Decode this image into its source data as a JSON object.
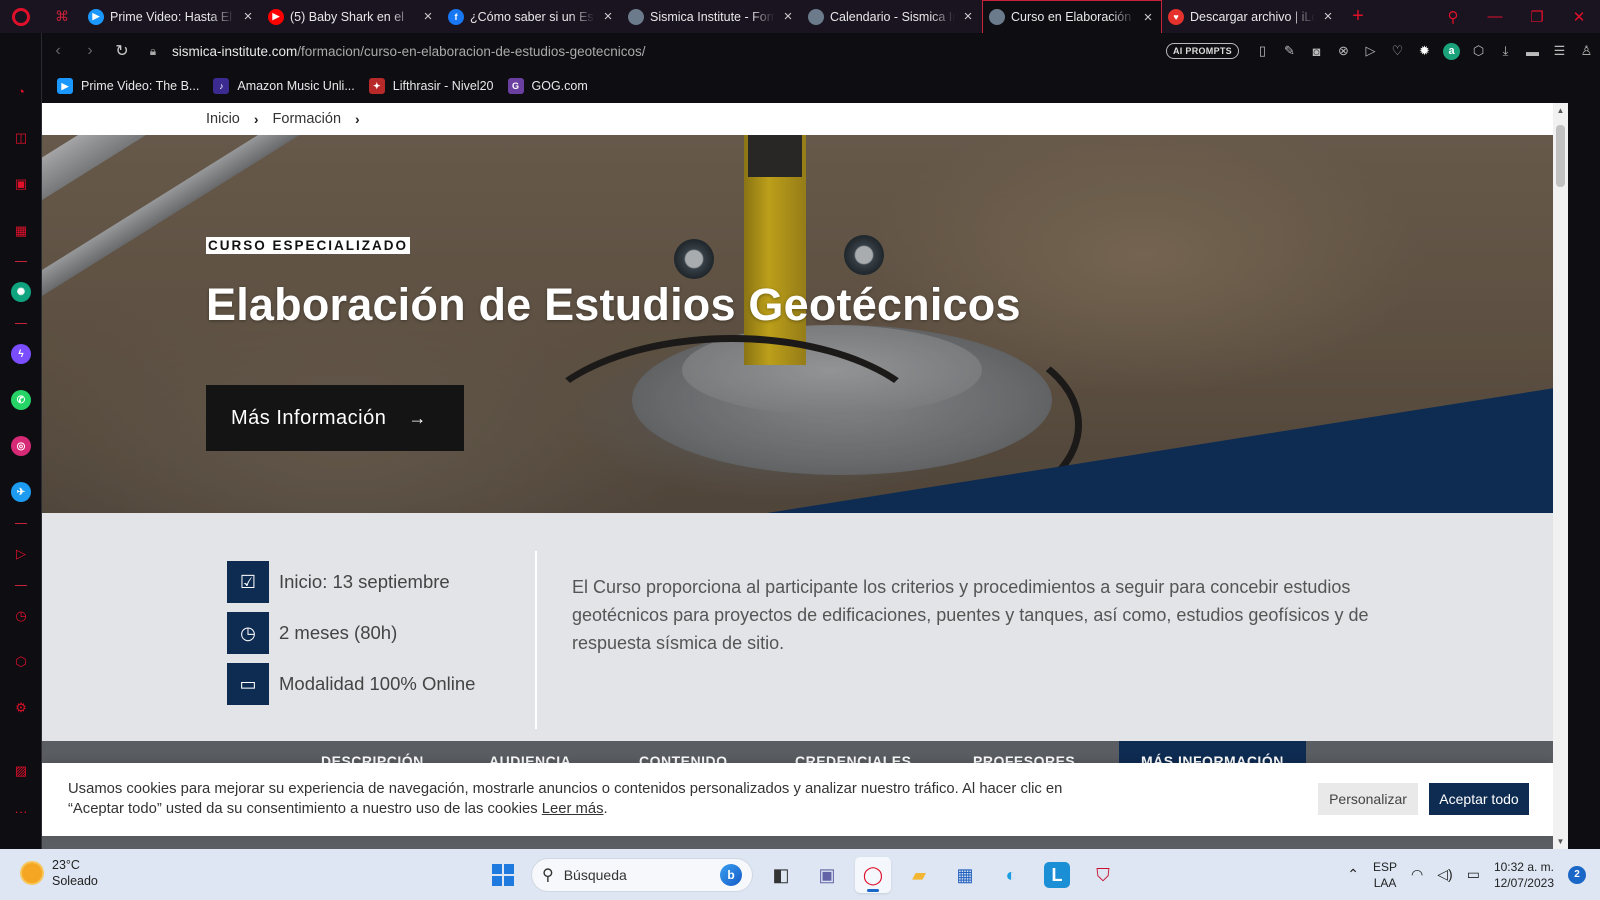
{
  "browser": {
    "tabs": [
      {
        "title": "Prime Video: Hasta El Ú",
        "favicon": "prime-video-icon",
        "color": "#1a98ff",
        "letter": "▶"
      },
      {
        "title": "(5) Baby Shark en el",
        "favicon": "youtube-icon",
        "color": "#ff0000",
        "letter": "▶"
      },
      {
        "title": "¿Cómo saber si un Estu",
        "favicon": "facebook-icon",
        "color": "#1877f2",
        "letter": "f"
      },
      {
        "title": "Sismica Institute - Form",
        "favicon": "globe-icon",
        "color": "#6b7b8c",
        "letter": ""
      },
      {
        "title": "Calendario - Sismica In",
        "favicon": "globe-icon",
        "color": "#6b7b8c",
        "letter": ""
      },
      {
        "title": "Curso en Elaboración d",
        "favicon": "globe-icon",
        "color": "#6b7b8c",
        "letter": "",
        "active": true
      },
      {
        "title": "Descargar archivo | iLov",
        "favicon": "heart-icon",
        "color": "#e5322d",
        "letter": "♥"
      }
    ],
    "url_domain": "sismica-institute.com",
    "url_path": "/formacion/curso-en-elaboracion-de-estudios-geotecnicos/",
    "ai_prompts_label": "AI PROMPTS",
    "bookmarks": [
      {
        "label": "Prime Video: The B...",
        "icon": "prime-video-icon",
        "color": "#1a98ff",
        "glyph": "▶"
      },
      {
        "label": "Amazon Music Unli...",
        "icon": "amazon-music-icon",
        "color": "#3b2a8f",
        "glyph": "♪"
      },
      {
        "label": "Lifthrasir - Nivel20",
        "icon": "nivel20-icon",
        "color": "#b82a2a",
        "glyph": "✦"
      },
      {
        "label": "GOG.com",
        "icon": "gog-icon",
        "color": "#6a3fa0",
        "glyph": "G"
      }
    ]
  },
  "page": {
    "breadcrumb": [
      "Inicio",
      "Formación"
    ],
    "hero": {
      "badge": "CURSO ESPECIALIZADO",
      "title": "Elaboración de Estudios Geotécnicos",
      "cta_label": "Más Información",
      "cta_arrow": "→"
    },
    "facts": [
      {
        "icon": "calendar-check-icon",
        "glyph": "☑",
        "text": "Inicio: 13 septiembre"
      },
      {
        "icon": "clock-icon",
        "glyph": "◷",
        "text": "2 meses (80h)"
      },
      {
        "icon": "laptop-icon",
        "glyph": "▭",
        "text": "Modalidad 100% Online"
      }
    ],
    "description": "El Curso proporciona al participante los criterios y procedimientos a seguir para concebir estudios geotécnicos para proyectos de edificaciones, puentes y tanques, así como, estudios geofísicos y de respuesta sísmica de sitio.",
    "section_tabs": [
      "DESCRIPCIÓN",
      "AUDIENCIA",
      "CONTENIDO",
      "CREDENCIALES",
      "PROFESORES",
      "MÁS INFORMACIÓN"
    ],
    "cookie": {
      "text": "Usamos cookies para mejorar su experiencia de navegación, mostrarle anuncios o contenidos personalizados y analizar nuestro tráfico. Al hacer clic en “Aceptar todo” usted da su consentimiento a nuestro uso de las cookies",
      "link": "Leer más",
      "customize_label": "Personalizar",
      "accept_label": "Aceptar todo"
    }
  },
  "taskbar": {
    "weather_temp": "23°C",
    "weather_desc": "Soleado",
    "search_placeholder": "Búsqueda",
    "lang_line1": "ESP",
    "lang_line2": "LAA",
    "time": "10:32 a. m.",
    "date": "12/07/2023",
    "notifications": "2"
  },
  "colors": {
    "accent": "#e0102b",
    "navy": "#0e2c52"
  }
}
